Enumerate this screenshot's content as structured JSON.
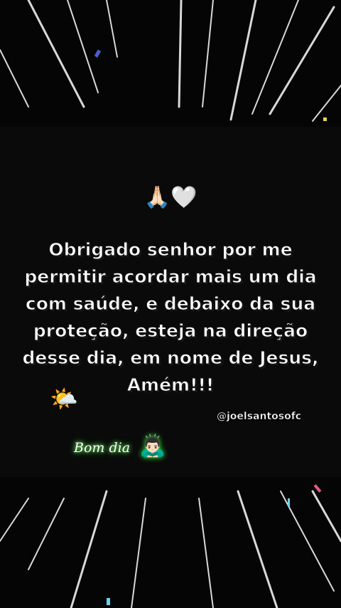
{
  "story": {
    "emoji_top": "🙏🏻🤍",
    "message": "Obrigado senhor por me permitir acordar mais um dia com saúde, e debaixo da sua proteção, esteja na direção desse dia, em nome de Jesus, Amém!!!",
    "handle": "@joelsantosofc",
    "sun_emoji": "🌤️",
    "greeting": "Bom dia",
    "greeting_emoji": "🙇🏻‍♂️"
  },
  "colors": {
    "background": "#050505",
    "card": "#0a0a0a",
    "text": "#ffffff",
    "glow": "#7cff6b"
  },
  "icons": [
    "praying-hands-icon",
    "white-heart-icon",
    "sun-behind-cloud-icon",
    "bowing-man-icon"
  ]
}
